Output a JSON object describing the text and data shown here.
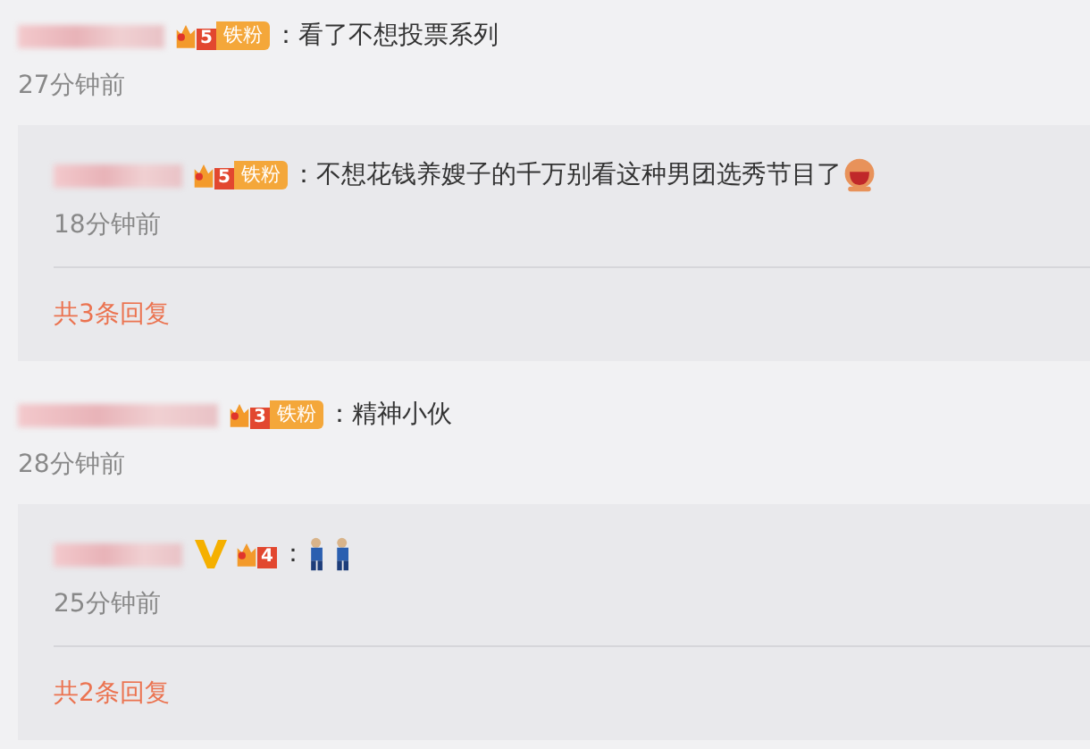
{
  "comments": [
    {
      "verified": false,
      "badge": {
        "level": "5",
        "label": "铁粉"
      },
      "separator": "：",
      "content": [
        {
          "kind": "text",
          "text": "看了不想投票系列"
        }
      ],
      "time": "27分钟前",
      "replies": [
        {
          "verified": false,
          "badge": {
            "level": "5",
            "label": "铁粉"
          },
          "separator": "：",
          "content": [
            {
              "kind": "text",
              "text": "不想花钱养嫂子的千万别看这种男团选秀节目了"
            },
            {
              "kind": "emoji"
            }
          ],
          "time": "18分钟前"
        }
      ],
      "more": "共3条回复"
    },
    {
      "verified": false,
      "badge": {
        "level": "3",
        "label": "铁粉"
      },
      "separator": "：",
      "content": [
        {
          "kind": "text",
          "text": "精神小伙"
        }
      ],
      "time": "28分钟前",
      "replies": [
        {
          "verified": true,
          "badge": {
            "level": "4"
          },
          "separator": "：",
          "content": [
            {
              "kind": "emoji-figures"
            }
          ],
          "time": "25分钟前"
        }
      ],
      "more": "共2条回复"
    }
  ]
}
